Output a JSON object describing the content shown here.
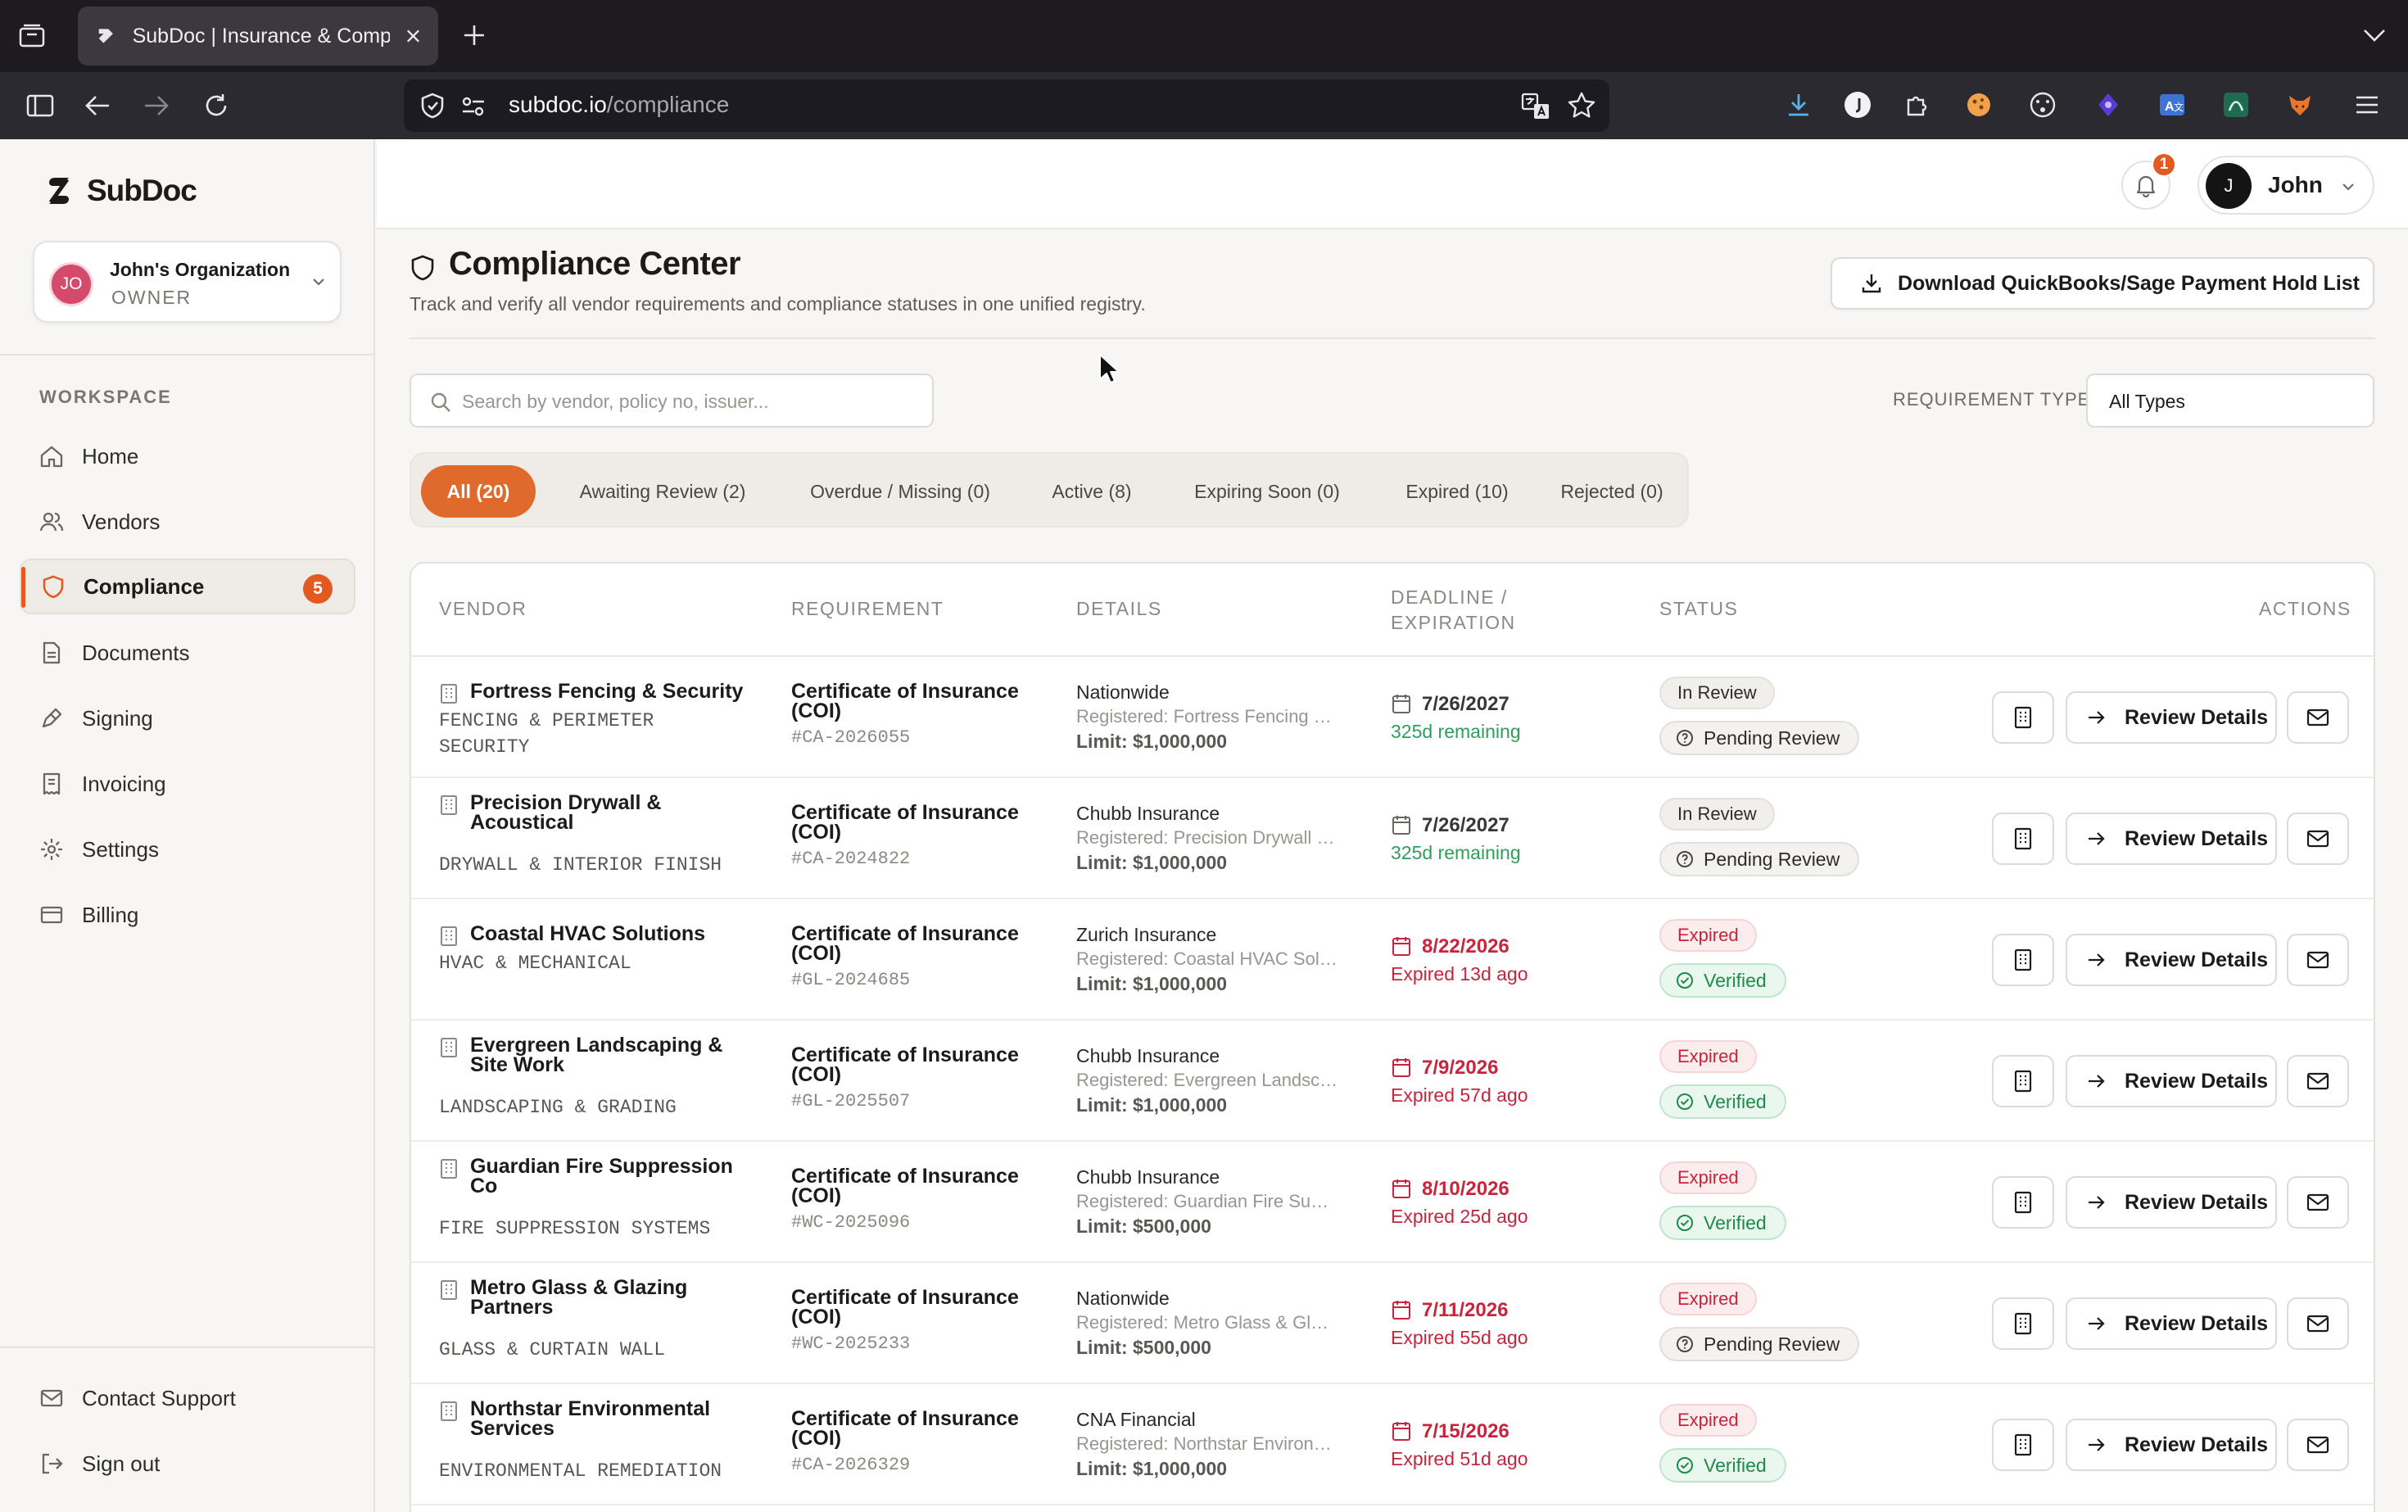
{
  "browser": {
    "tab_title": "SubDoc | Insurance & Compliance",
    "url_domain": "subdoc.io",
    "url_path": "/compliance"
  },
  "sidebar": {
    "logo": "SubDoc",
    "org": {
      "initials": "JO",
      "name": "John's Organization",
      "role": "OWNER"
    },
    "workspace_label": "WORKSPACE",
    "items": [
      {
        "label": "Home",
        "icon": "home-icon"
      },
      {
        "label": "Vendors",
        "icon": "users-icon"
      },
      {
        "label": "Compliance",
        "icon": "shield-icon",
        "badge": "5",
        "active": true
      },
      {
        "label": "Documents",
        "icon": "document-icon"
      },
      {
        "label": "Signing",
        "icon": "pen-icon"
      },
      {
        "label": "Invoicing",
        "icon": "receipt-icon"
      },
      {
        "label": "Settings",
        "icon": "gear-icon"
      },
      {
        "label": "Billing",
        "icon": "card-icon"
      }
    ],
    "footer": [
      {
        "label": "Contact Support",
        "icon": "mail-icon"
      },
      {
        "label": "Sign out",
        "icon": "logout-icon"
      }
    ]
  },
  "topbar": {
    "notif_count": "1",
    "user_initial": "J",
    "user_name": "John"
  },
  "page": {
    "title": "Compliance Center",
    "subtitle": "Track and verify all vendor requirements and compliance statuses in one unified registry.",
    "download_label": "Download QuickBooks/Sage Payment Hold List",
    "search_placeholder": "Search by vendor, policy no, issuer...",
    "req_type_label": "REQUIREMENT TYPE:",
    "req_type_value": "All Types"
  },
  "filters": [
    {
      "label": "All (20)",
      "active": true
    },
    {
      "label": "Awaiting Review (2)"
    },
    {
      "label": "Overdue / Missing (0)"
    },
    {
      "label": "Active (8)"
    },
    {
      "label": "Expiring Soon (0)"
    },
    {
      "label": "Expired (10)"
    },
    {
      "label": "Rejected (0)"
    }
  ],
  "table": {
    "headers": {
      "vendor": "VENDOR",
      "requirement": "REQUIREMENT",
      "details": "DETAILS",
      "deadline_1": "DEADLINE /",
      "deadline_2": "EXPIRATION",
      "status": "STATUS",
      "actions": "ACTIONS"
    },
    "review_label": "Review Details",
    "rows": [
      {
        "vendor_1": "Fortress Fencing & Security",
        "vendor_2": "",
        "category_1": "FENCING & PERIMETER",
        "category_2": "SECURITY",
        "req_1": "Certificate of Insurance",
        "req_2": "(COI)",
        "req_id": "#CA-2026055",
        "insurer": "Nationwide",
        "registered": "Registered: Fortress Fencing & Security",
        "limit": "Limit: $1,000,000",
        "date": "7/26/2027",
        "remaining": "325d remaining",
        "status": "In Review",
        "verify": "Pending Review",
        "state": "ok",
        "verify_kind": "pending"
      },
      {
        "vendor_1": "Precision Drywall &",
        "vendor_2": "Acoustical",
        "category_1": "DRYWALL & INTERIOR FINISH",
        "category_2": "",
        "req_1": "Certificate of Insurance",
        "req_2": "(COI)",
        "req_id": "#CA-2024822",
        "insurer": "Chubb Insurance",
        "registered": "Registered: Precision Drywall & Acoustical",
        "limit": "Limit: $1,000,000",
        "date": "7/26/2027",
        "remaining": "325d remaining",
        "status": "In Review",
        "verify": "Pending Review",
        "state": "ok",
        "verify_kind": "pending"
      },
      {
        "vendor_1": "Coastal HVAC Solutions",
        "vendor_2": "",
        "category_1": "HVAC & MECHANICAL",
        "category_2": "",
        "req_1": "Certificate of Insurance",
        "req_2": "(COI)",
        "req_id": "#GL-2024685",
        "insurer": "Zurich Insurance",
        "registered": "Registered: Coastal HVAC Solutions",
        "limit": "Limit: $1,000,000",
        "date": "8/22/2026",
        "remaining": "Expired 13d ago",
        "status": "Expired",
        "verify": "Verified",
        "state": "expired",
        "verify_kind": "verified"
      },
      {
        "vendor_1": "Evergreen Landscaping &",
        "vendor_2": "Site Work",
        "category_1": "LANDSCAPING & GRADING",
        "category_2": "",
        "req_1": "Certificate of Insurance",
        "req_2": "(COI)",
        "req_id": "#GL-2025507",
        "insurer": "Chubb Insurance",
        "registered": "Registered: Evergreen Landscaping & Site Work",
        "limit": "Limit: $1,000,000",
        "date": "7/9/2026",
        "remaining": "Expired 57d ago",
        "status": "Expired",
        "verify": "Verified",
        "state": "expired",
        "verify_kind": "verified"
      },
      {
        "vendor_1": "Guardian Fire Suppression",
        "vendor_2": "Co",
        "category_1": "FIRE SUPPRESSION SYSTEMS",
        "category_2": "",
        "req_1": "Certificate of Insurance",
        "req_2": "(COI)",
        "req_id": "#WC-2025096",
        "insurer": "Chubb Insurance",
        "registered": "Registered: Guardian Fire Suppression Co",
        "limit": "Limit: $500,000",
        "date": "8/10/2026",
        "remaining": "Expired 25d ago",
        "status": "Expired",
        "verify": "Verified",
        "state": "expired",
        "verify_kind": "verified"
      },
      {
        "vendor_1": "Metro Glass & Glazing",
        "vendor_2": "Partners",
        "category_1": "GLASS & CURTAIN WALL",
        "category_2": "",
        "req_1": "Certificate of Insurance",
        "req_2": "(COI)",
        "req_id": "#WC-2025233",
        "insurer": "Nationwide",
        "registered": "Registered: Metro Glass & Glazing Partners",
        "limit": "Limit: $500,000",
        "date": "7/11/2026",
        "remaining": "Expired 55d ago",
        "status": "Expired",
        "verify": "Pending Review",
        "state": "expired",
        "verify_kind": "pending"
      },
      {
        "vendor_1": "Northstar Environmental",
        "vendor_2": "Services",
        "category_1": "ENVIRONMENTAL REMEDIATION",
        "category_2": "",
        "req_1": "Certificate of Insurance",
        "req_2": "(COI)",
        "req_id": "#CA-2026329",
        "insurer": "CNA Financial",
        "registered": "Registered: Northstar Environmental Services",
        "limit": "Limit: $1,000,000",
        "date": "7/15/2026",
        "remaining": "Expired 51d ago",
        "status": "Expired",
        "verify": "Verified",
        "state": "expired",
        "verify_kind": "verified"
      }
    ]
  },
  "colors": {
    "accent": "#e25a22",
    "expired": "#c8243c",
    "ok": "#2f9e5c"
  }
}
